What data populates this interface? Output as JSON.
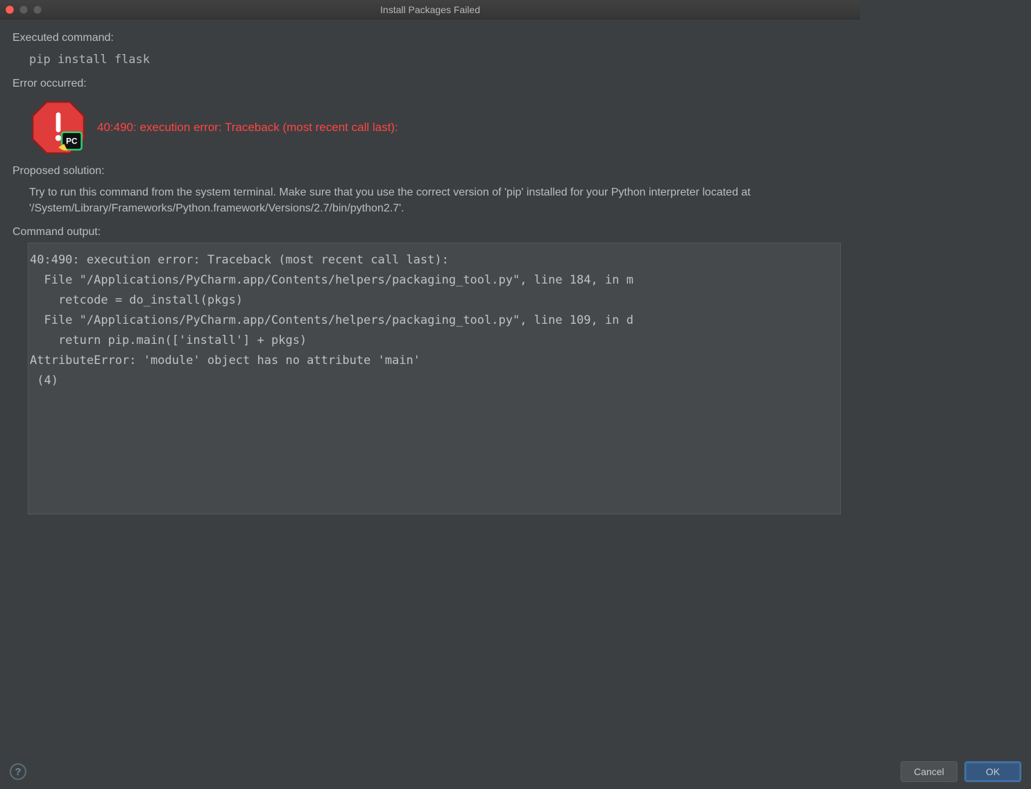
{
  "window": {
    "title": "Install Packages Failed"
  },
  "labels": {
    "executed": "Executed command:",
    "errorOccurred": "Error occurred:",
    "proposed": "Proposed solution:",
    "commandOutput": "Command output:"
  },
  "command": "pip install flask",
  "errorHeadline": "40:490: execution error: Traceback (most recent call last):",
  "solution": "Try to run this command from the system terminal. Make sure that you use the correct version of 'pip' installed for your Python interpreter located at '/System/Library/Frameworks/Python.framework/Versions/2.7/bin/python2.7'.",
  "output": "40:490: execution error: Traceback (most recent call last):\n  File \"/Applications/PyCharm.app/Contents/helpers/packaging_tool.py\", line 184, in m\n    retcode = do_install(pkgs)\n  File \"/Applications/PyCharm.app/Contents/helpers/packaging_tool.py\", line 109, in d\n    return pip.main(['install'] + pkgs)\nAttributeError: 'module' object has no attribute 'main'\n (4)",
  "buttons": {
    "cancel": "Cancel",
    "ok": "OK"
  },
  "help": "?"
}
